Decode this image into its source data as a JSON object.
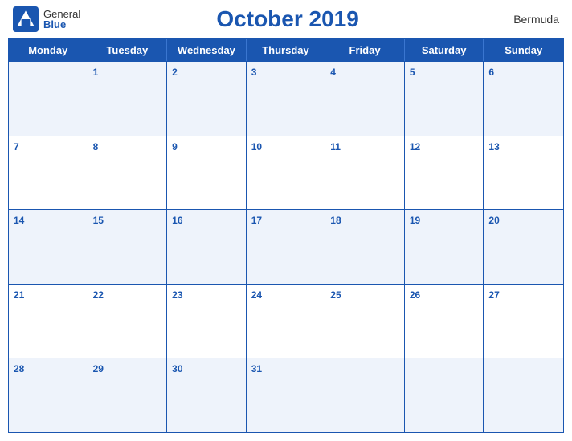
{
  "header": {
    "logo_general": "General",
    "logo_blue": "Blue",
    "title": "October 2019",
    "region": "Bermuda"
  },
  "days_of_week": [
    "Monday",
    "Tuesday",
    "Wednesday",
    "Thursday",
    "Friday",
    "Saturday",
    "Sunday"
  ],
  "weeks": [
    [
      {
        "day": "",
        "empty": true
      },
      {
        "day": "1"
      },
      {
        "day": "2"
      },
      {
        "day": "3"
      },
      {
        "day": "4"
      },
      {
        "day": "5"
      },
      {
        "day": "6"
      }
    ],
    [
      {
        "day": "7"
      },
      {
        "day": "8"
      },
      {
        "day": "9"
      },
      {
        "day": "10"
      },
      {
        "day": "11"
      },
      {
        "day": "12"
      },
      {
        "day": "13"
      }
    ],
    [
      {
        "day": "14"
      },
      {
        "day": "15"
      },
      {
        "day": "16"
      },
      {
        "day": "17"
      },
      {
        "day": "18"
      },
      {
        "day": "19"
      },
      {
        "day": "20"
      }
    ],
    [
      {
        "day": "21"
      },
      {
        "day": "22"
      },
      {
        "day": "23"
      },
      {
        "day": "24"
      },
      {
        "day": "25"
      },
      {
        "day": "26"
      },
      {
        "day": "27"
      }
    ],
    [
      {
        "day": "28"
      },
      {
        "day": "29"
      },
      {
        "day": "30"
      },
      {
        "day": "31"
      },
      {
        "day": ""
      },
      {
        "day": ""
      },
      {
        "day": ""
      }
    ]
  ],
  "colors": {
    "primary_blue": "#1a56b0",
    "light_blue_bg": "#eef3fb"
  }
}
